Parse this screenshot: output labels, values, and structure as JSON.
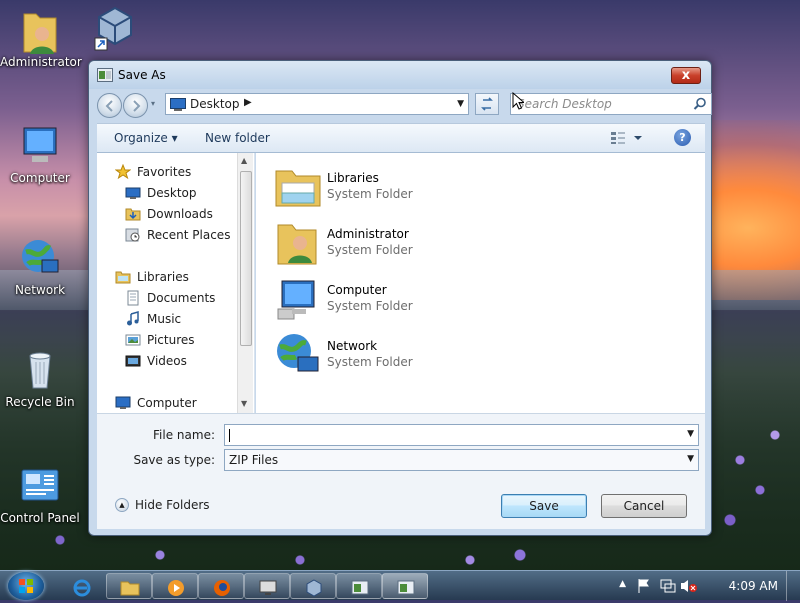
{
  "desktop": {
    "icons": [
      {
        "label": "Administrator"
      },
      {
        "label": "Computer"
      },
      {
        "label": "Network"
      },
      {
        "label": "Recycle Bin"
      },
      {
        "label": "Control Panel"
      }
    ]
  },
  "dialog": {
    "title": "Save As",
    "close_label": "x",
    "address": {
      "location": "Desktop",
      "arrow": "▶"
    },
    "search": {
      "placeholder": "Search Desktop"
    },
    "toolbar": {
      "organize": "Organize ▾",
      "new_folder": "New folder",
      "help": "?"
    },
    "nav": {
      "favorites": "Favorites",
      "desktop": "Desktop",
      "downloads": "Downloads",
      "recent": "Recent Places",
      "libraries": "Libraries",
      "documents": "Documents",
      "music": "Music",
      "pictures": "Pictures",
      "videos": "Videos",
      "computer": "Computer"
    },
    "items": [
      {
        "name": "Libraries",
        "type": "System Folder"
      },
      {
        "name": "Administrator",
        "type": "System Folder"
      },
      {
        "name": "Computer",
        "type": "System Folder"
      },
      {
        "name": "Network",
        "type": "System Folder"
      }
    ],
    "file_name_label": "File name:",
    "file_name_value": "",
    "save_type_label": "Save as type:",
    "save_type_value": "ZIP Files",
    "hide_folders": "Hide Folders",
    "save_button": "Save",
    "cancel_button": "Cancel"
  },
  "taskbar": {
    "clock": "4:09 AM"
  }
}
